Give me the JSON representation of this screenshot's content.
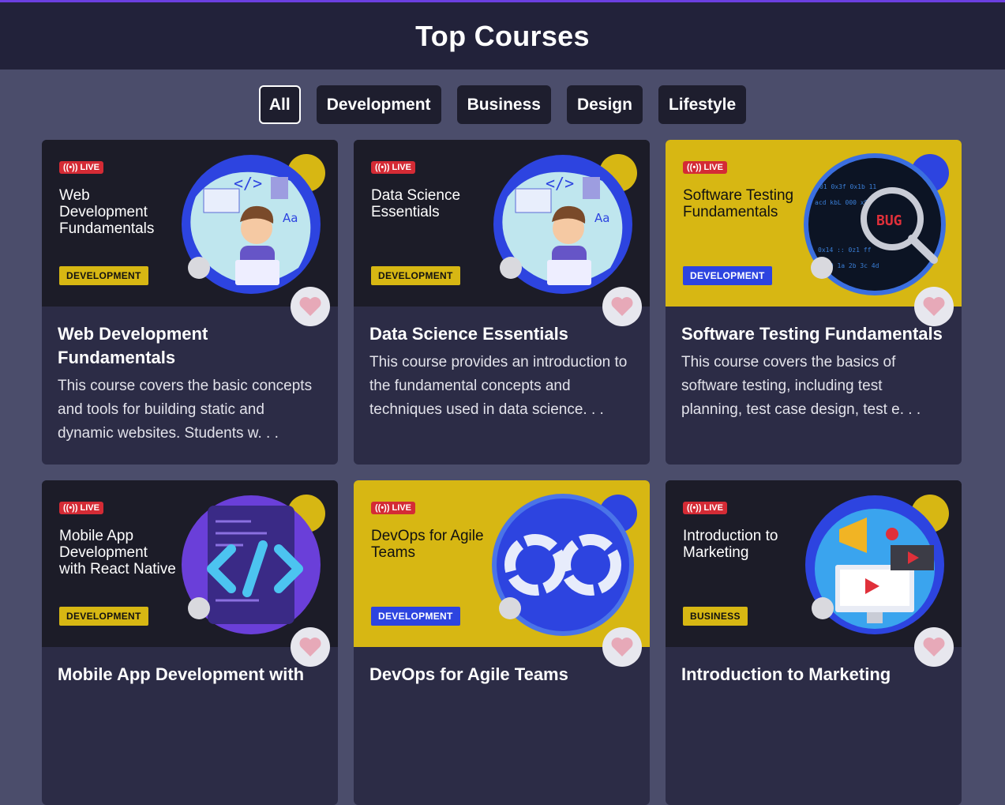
{
  "header": {
    "title": "Top Courses"
  },
  "filters": [
    {
      "label": "All",
      "active": true
    },
    {
      "label": "Development",
      "active": false
    },
    {
      "label": "Business",
      "active": false
    },
    {
      "label": "Design",
      "active": false
    },
    {
      "label": "Lifestyle",
      "active": false
    }
  ],
  "live_label": "LIVE",
  "courses": [
    {
      "banner_title": "Web Development Fundamentals",
      "tag": "DEVELOPMENT",
      "title": "Web Development Fundamentals",
      "description": "This course covers the basic concepts and tools for building static and dynamic websites. Students w. . ."
    },
    {
      "banner_title": "Data Science Essentials",
      "tag": "DEVELOPMENT",
      "title": "Data Science Essentials",
      "description": "This course provides an introduction to the fundamental concepts and techniques used in data science. . ."
    },
    {
      "banner_title": "Software Testing Fundamentals",
      "tag": "DEVELOPMENT",
      "title": "Software Testing Fundamentals",
      "description": "This course covers the basics of software testing, including test planning, test case design, test e. . ."
    },
    {
      "banner_title": "Mobile App Development with React Native",
      "tag": "DEVELOPMENT",
      "title": "Mobile App Development with",
      "description": ""
    },
    {
      "banner_title": "DevOps for Agile Teams",
      "tag": "DEVELOPMENT",
      "title": "DevOps for Agile Teams",
      "description": ""
    },
    {
      "banner_title": "Introduction to Marketing",
      "tag": "BUSINESS",
      "title": "Introduction to Marketing",
      "description": ""
    }
  ],
  "icons": {
    "live": "broadcast-icon",
    "favorite": "heart-icon"
  },
  "colors": {
    "header_bg": "#22223a",
    "page_bg": "#4b4d6b",
    "card_bg": "#2c2c46",
    "accent_yellow": "#d7b713",
    "accent_blue": "#2d44e0",
    "live_red": "#d42b35",
    "heart": "#e7a9b8"
  }
}
